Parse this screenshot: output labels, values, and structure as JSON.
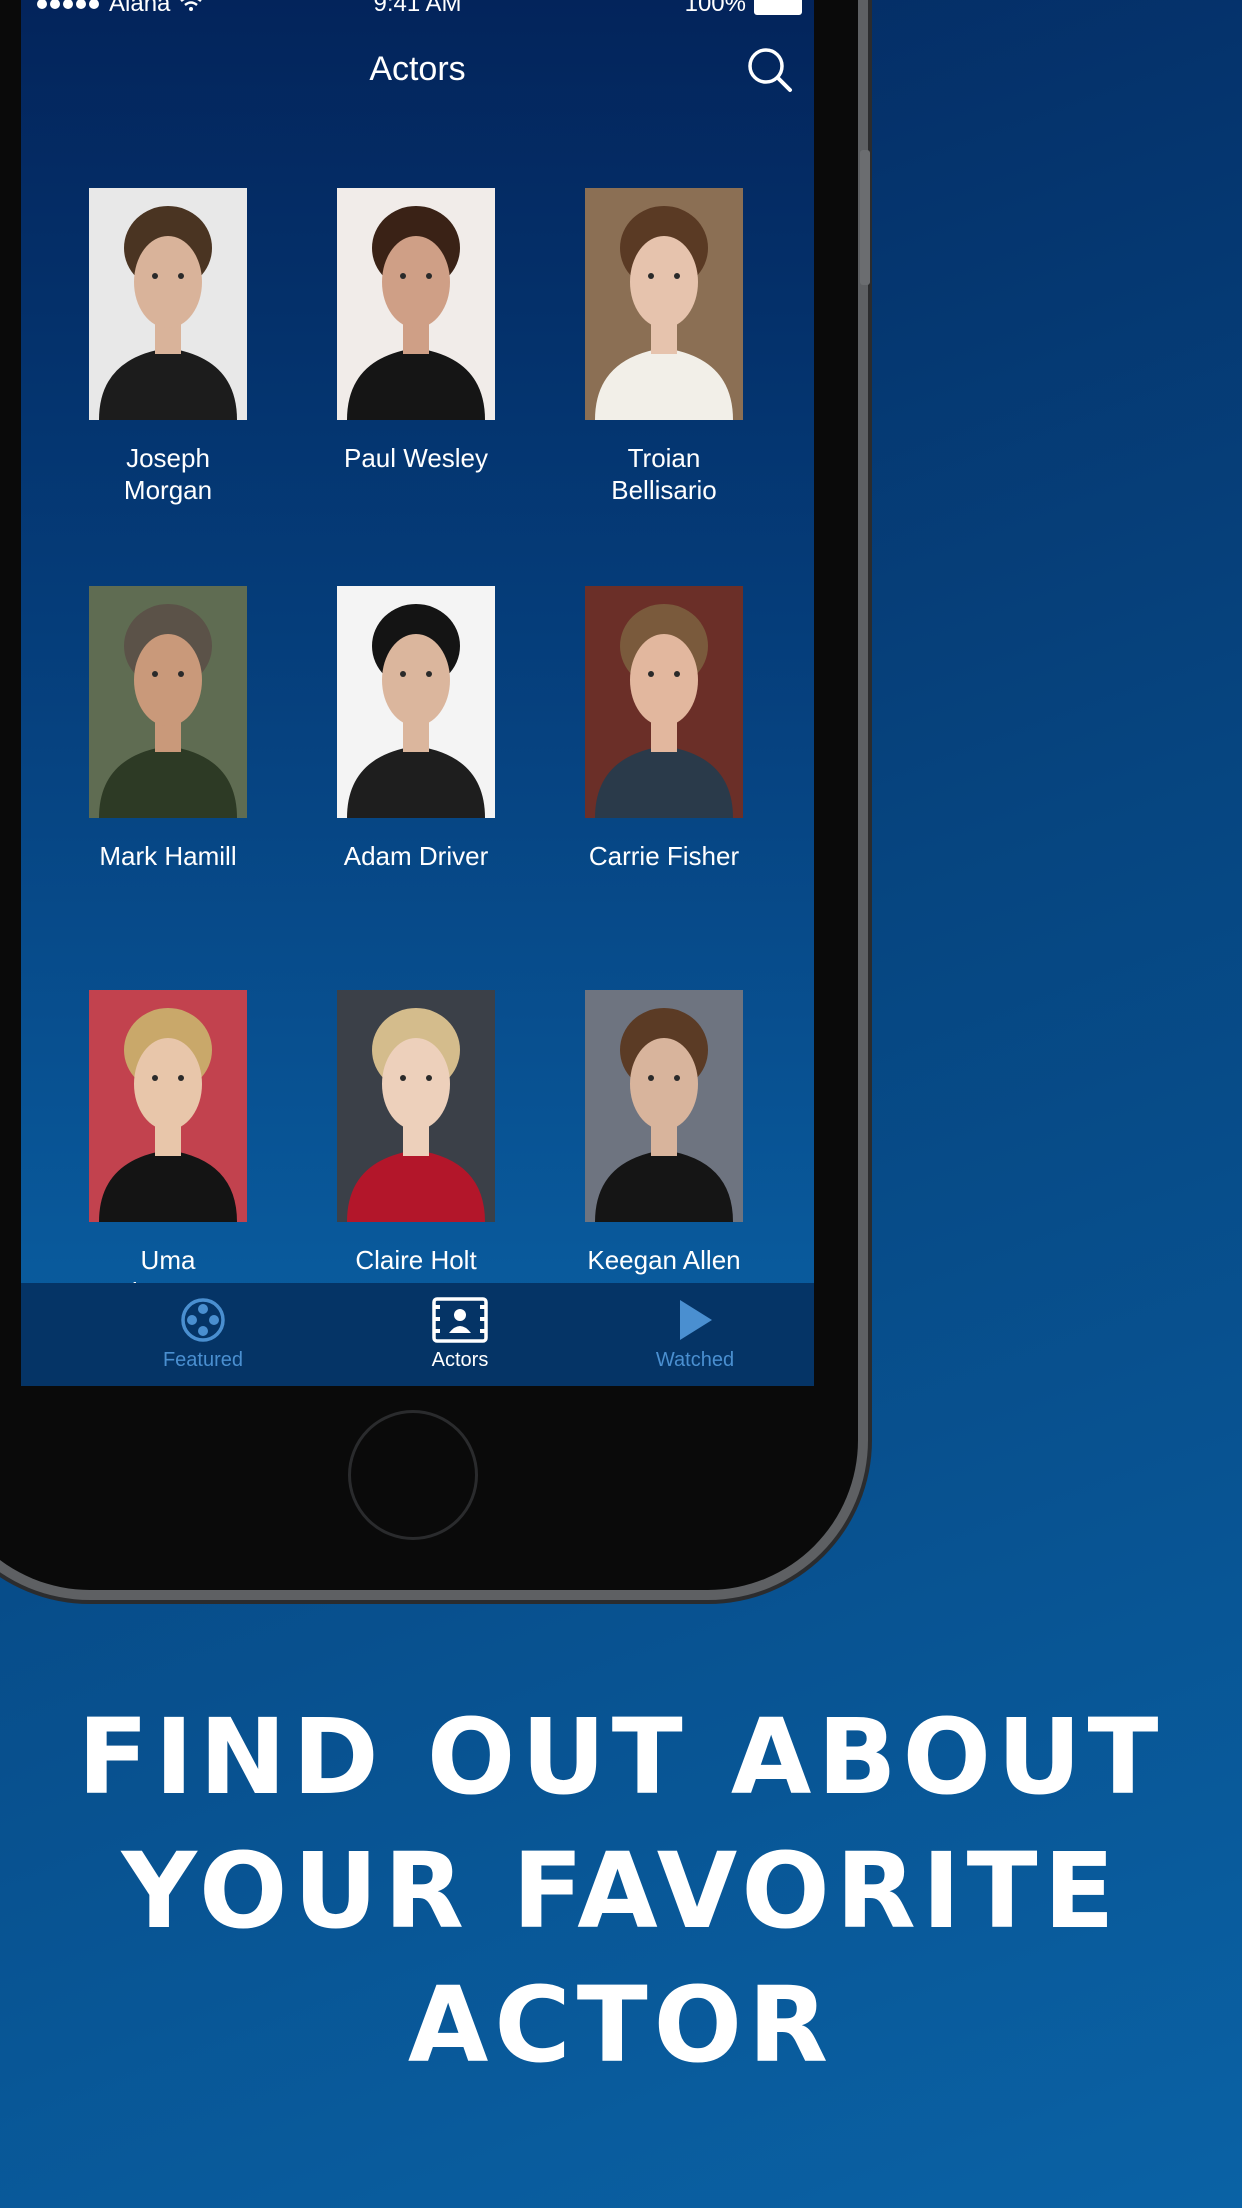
{
  "status_bar": {
    "carrier": "Alana",
    "time": "9:41 AM",
    "battery": "100%"
  },
  "navbar": {
    "title": "Actors",
    "search_icon": "search-icon"
  },
  "actors": [
    {
      "name": "Joseph Morgan",
      "line1": "Joseph",
      "line2": "Morgan",
      "bg": "#e8e8e8",
      "hair": "#4a3422",
      "skin": "#d9b39a",
      "cloth": "#1c1c1c"
    },
    {
      "name": "Paul Wesley",
      "line1": "Paul Wesley",
      "line2": "",
      "bg": "#f1ece9",
      "hair": "#3a2216",
      "skin": "#cf9f86",
      "cloth": "#151515"
    },
    {
      "name": "Troian Bellisario",
      "line1": "Troian",
      "line2": "Bellisario",
      "bg": "#8b6f54",
      "hair": "#5a3a24",
      "skin": "#e6c3ad",
      "cloth": "#f2efe8"
    },
    {
      "name": "Mark Hamill",
      "line1": "Mark Hamill",
      "line2": "",
      "bg": "#5f6c52",
      "hair": "#5b5248",
      "skin": "#c9997a",
      "cloth": "#2d3a25"
    },
    {
      "name": "Adam Driver",
      "line1": "Adam Driver",
      "line2": "",
      "bg": "#f4f4f4",
      "hair": "#141414",
      "skin": "#dbb69d",
      "cloth": "#1e1e1e"
    },
    {
      "name": "Carrie Fisher",
      "line1": "Carrie Fisher",
      "line2": "",
      "bg": "#6b2f28",
      "hair": "#7a5a3c",
      "skin": "#e2b79e",
      "cloth": "#2a3a4a"
    },
    {
      "name": "Uma Thurman",
      "line1": "Uma",
      "line2": "Thurman",
      "bg": "#c2424e",
      "hair": "#c9a86a",
      "skin": "#e8c6aa",
      "cloth": "#141414"
    },
    {
      "name": "Claire Holt",
      "line1": "Claire Holt",
      "line2": "",
      "bg": "#3b4048",
      "hair": "#d4bc8c",
      "skin": "#edd0bb",
      "cloth": "#b3162a"
    },
    {
      "name": "Keegan Allen",
      "line1": "Keegan Allen",
      "line2": "",
      "bg": "#6e7480",
      "hair": "#5b3b25",
      "skin": "#d8b49c",
      "cloth": "#151515"
    }
  ],
  "tabbar": {
    "tabs": [
      {
        "label": "Featured",
        "icon": "film-reel-icon",
        "active": false
      },
      {
        "label": "Actors",
        "icon": "actor-card-icon",
        "active": true
      },
      {
        "label": "Watched",
        "icon": "play-icon",
        "active": false
      }
    ]
  },
  "headline": {
    "line1": "FIND OUT ABOUT",
    "line2": "YOUR FAVORITE",
    "line3": "ACTOR"
  },
  "colors": {
    "inactive_tab": "#4a8fd0",
    "background_top": "#04275f",
    "background_bottom": "#0a62a5"
  }
}
